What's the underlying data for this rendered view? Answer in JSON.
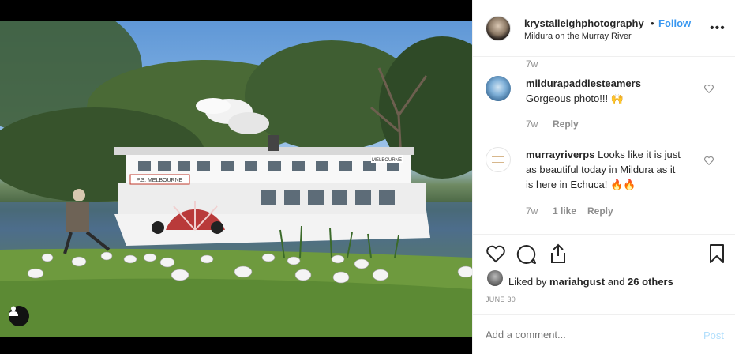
{
  "post": {
    "username": "krystalleighphotography",
    "separator": "•",
    "follow_label": "Follow",
    "location": "Mildura on the Murray River",
    "more_label": "•••"
  },
  "comments": {
    "prev_time": "7w",
    "items": [
      {
        "username": "mildurapaddlesteamers",
        "text": "Gorgeous photo!!! 🙌",
        "time": "7w",
        "reply_label": "Reply"
      },
      {
        "username": "murrayriverps",
        "text_line1": "Looks like it is just",
        "text_line2": "as beautiful today in Mildura as it",
        "text_line3": "is here in Echuca! 🔥🔥",
        "time": "7w",
        "likes": "1 like",
        "reply_label": "Reply"
      }
    ]
  },
  "likes": {
    "prefix": "Liked by ",
    "user": "mariahgust",
    "middle": " and ",
    "others": "26 others"
  },
  "date": "JUNE 30",
  "add_comment": {
    "placeholder": "Add a comment...",
    "post_label": "Post"
  },
  "photo": {
    "boat_name": "P.S. MELBOURNE",
    "boat_name_side": "MELBOURNE"
  },
  "colors": {
    "link_blue": "#3897f0",
    "post_disabled": "#b2dffc",
    "meta_gray": "#8e8e8e"
  }
}
